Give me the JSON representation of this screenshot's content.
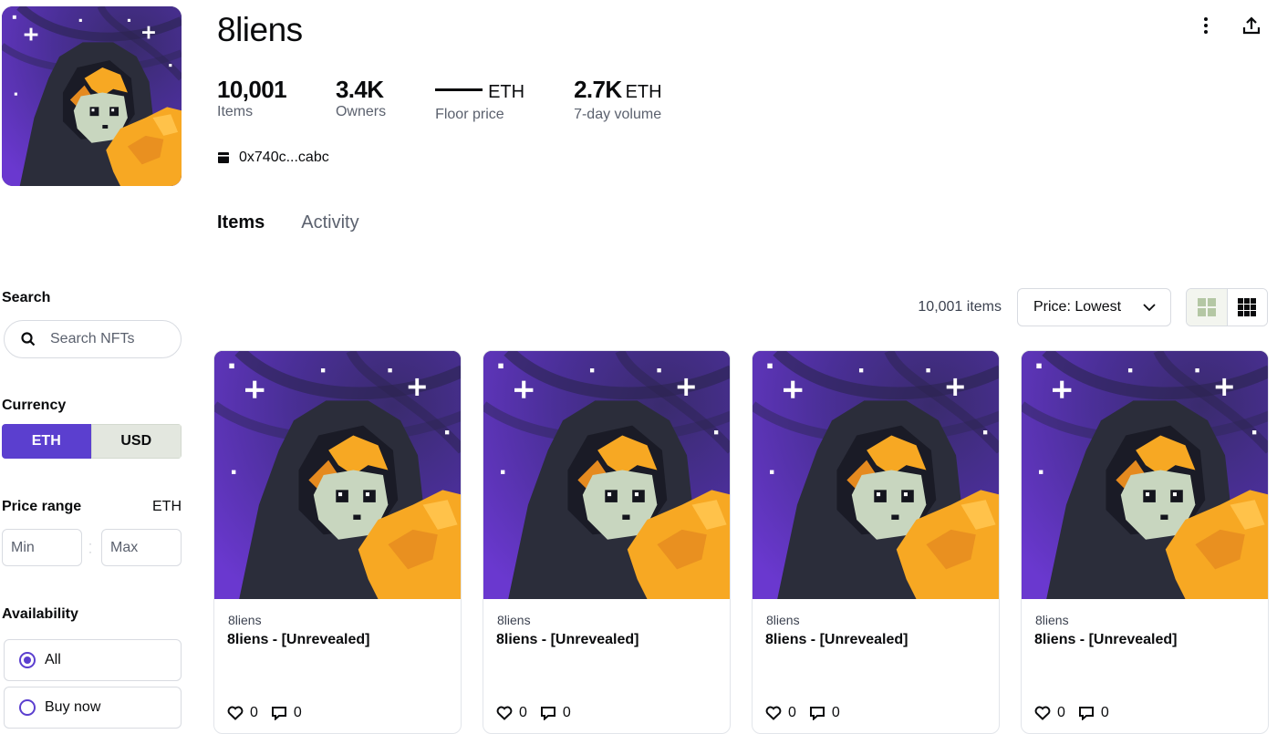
{
  "collection": {
    "title": "8liens",
    "contract": "0x740c...cabc"
  },
  "stats": [
    {
      "value": "10,001",
      "unit": "",
      "label": "Items"
    },
    {
      "value": "3.4K",
      "unit": "",
      "label": "Owners"
    },
    {
      "value": "",
      "unit": "ETH",
      "label": "Floor price",
      "dash": true
    },
    {
      "value": "2.7K",
      "unit": "ETH",
      "label": "7-day volume"
    }
  ],
  "tabs": [
    {
      "label": "Items",
      "active": true
    },
    {
      "label": "Activity",
      "active": false
    }
  ],
  "filters": {
    "search": {
      "heading": "Search",
      "placeholder": "Search NFTs"
    },
    "currency": {
      "heading": "Currency",
      "options": [
        "ETH",
        "USD"
      ],
      "selected": "ETH"
    },
    "price_range": {
      "heading": "Price range",
      "unit": "ETH",
      "min_placeholder": "Min",
      "max_placeholder": "Max"
    },
    "availability": {
      "heading": "Availability",
      "options": [
        {
          "label": "All",
          "checked": true
        },
        {
          "label": "Buy now",
          "checked": false
        }
      ]
    }
  },
  "toolbar": {
    "item_count": "10,001 items",
    "sort_label": "Price: Lowest"
  },
  "cards": [
    {
      "collection": "8liens",
      "name": "8liens - [Unrevealed]",
      "likes": "0",
      "comments": "0"
    },
    {
      "collection": "8liens",
      "name": "8liens - [Unrevealed]",
      "likes": "0",
      "comments": "0"
    },
    {
      "collection": "8liens",
      "name": "8liens - [Unrevealed]",
      "likes": "0",
      "comments": "0"
    },
    {
      "collection": "8liens",
      "name": "8liens - [Unrevealed]",
      "likes": "0",
      "comments": "0"
    }
  ],
  "colors": {
    "accent": "#5b3fcf",
    "space_purple": "#5a2fb4",
    "hood": "#2b2d3a",
    "hair_orange": "#f7a823",
    "skin": "#c8d6bf"
  }
}
